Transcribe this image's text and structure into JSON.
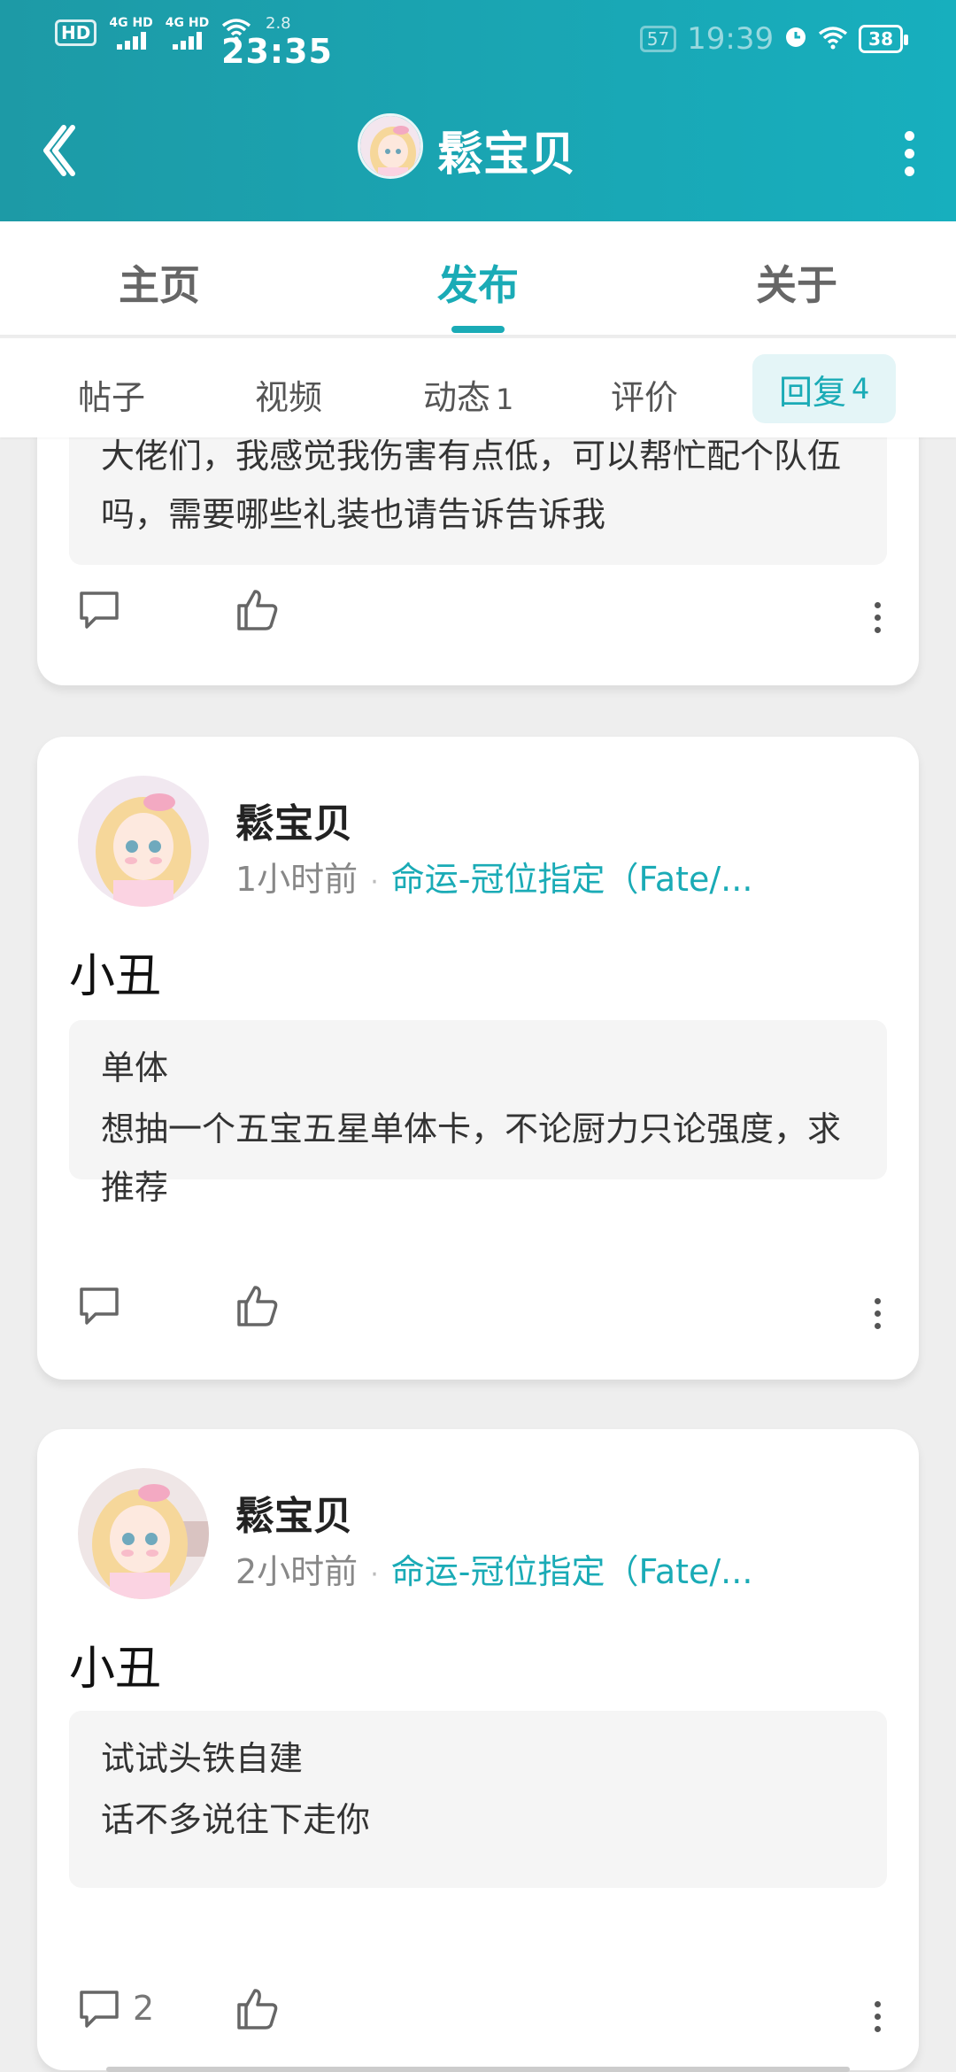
{
  "status_bar": {
    "hd_badge": "HD",
    "sim1": "4G HD",
    "sim2": "4G HD",
    "speed": "2.8",
    "time": "23:35",
    "notif_count": "57",
    "ghost_time": "19:39",
    "battery": "38"
  },
  "nav": {
    "title": "鬆宝贝",
    "colors": {
      "bar_start": "#1d9aa6",
      "bar_end": "#17afbe",
      "accent": "#1aabb6"
    }
  },
  "top_tabs": [
    {
      "label": "主页",
      "active": false
    },
    {
      "label": "发布",
      "active": true
    },
    {
      "label": "关于",
      "active": false
    }
  ],
  "sub_tabs": [
    {
      "label": "帖子",
      "count": ""
    },
    {
      "label": "视频",
      "count": ""
    },
    {
      "label": "动态",
      "count": "1"
    },
    {
      "label": "评价",
      "count": ""
    },
    {
      "label": "回复",
      "count": "4",
      "active": true
    }
  ],
  "posts": [
    {
      "partial": true,
      "quote_body": "大佬们，我感觉我伤害有点低，可以帮忙配个队伍吗，需要哪些礼装也请告诉告诉我",
      "comment_count": ""
    },
    {
      "author": "鬆宝贝",
      "time": "1小时前",
      "game": "命运-冠位指定（Fate/...",
      "title": "小丑",
      "quote_title": "单体",
      "quote_body": "想抽一个五宝五星单体卡，不论厨力只论强度，求推荐",
      "comment_count": ""
    },
    {
      "author": "鬆宝贝",
      "time": "2小时前",
      "game": "命运-冠位指定（Fate/...",
      "title": "小丑",
      "quote_title": "试试头铁自建",
      "quote_body": "话不多说往下走你",
      "comment_count": "2"
    }
  ]
}
